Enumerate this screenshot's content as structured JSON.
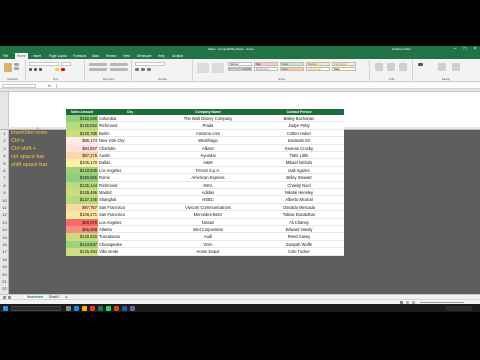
{
  "window": {
    "title": "Sales - Compatibility Mode - Excel",
    "user": "Charlie Kohler"
  },
  "ribbon_tabs": [
    "File",
    "Home",
    "Insert",
    "Page Layout",
    "Formulas",
    "Data",
    "Review",
    "View",
    "Developer",
    "Help",
    "Acrobat"
  ],
  "ribbon": {
    "groups": [
      "Clipboard",
      "Font",
      "Alignment",
      "Number",
      "Styles",
      "Cells",
      "Editing"
    ],
    "styles": [
      {
        "label": "Normal",
        "color": "#ffffff"
      },
      {
        "label": "Bad",
        "color": "#ffc7ce"
      },
      {
        "label": "Good",
        "color": "#c6efce"
      },
      {
        "label": "Neutral",
        "color": "#ffeb9c"
      },
      {
        "label": "Calculation",
        "color": "#f2f2f2"
      },
      {
        "label": "Check Cell",
        "color": "#a5a5a5"
      },
      {
        "label": "Explanatory",
        "color": "#ffffff"
      },
      {
        "label": "Input",
        "color": "#ffcc99"
      },
      {
        "label": "Linked Cell",
        "color": "#ffffff"
      },
      {
        "label": "Note",
        "color": "#ffffcc"
      }
    ]
  },
  "formula_bar": {
    "fx_label": "fx"
  },
  "notes": [
    "insert/del rows",
    "Ctrl s",
    "Ctrl shift +",
    "ctrl space bar",
    "shift space bar"
  ],
  "table": {
    "headers": [
      "Sales Amount",
      "City",
      "Company Name",
      "Contact Person"
    ],
    "rows": [
      {
        "amt": "$150,590",
        "city": "Columbia",
        "company": "The Walt Disney Company",
        "contact": "Bailey Buchanan",
        "color": "#8fcf7e"
      },
      {
        "amt": "$138,052",
        "city": "Richmond",
        "company": "Prada",
        "contact": "Jadyn Petty",
        "color": "#b6d97e"
      },
      {
        "amt": "$130,786",
        "city": "Berlin",
        "company": "Amazon.com",
        "contact": "Colten Huber",
        "color": "#c9dd7f"
      },
      {
        "amt": "$85,174",
        "city": "New York City",
        "company": "Westfriago",
        "contact": "Savanah Ori",
        "color": "#fde9e6"
      },
      {
        "amt": "$84,597",
        "city": "Charlotte",
        "company": "Allianz",
        "contact": "Keenan Crosby",
        "color": "#fbe1de"
      },
      {
        "amt": "$97,176",
        "city": "Austin",
        "company": "Hyundai",
        "contact": "Tahir Little",
        "color": "#fcd6a8"
      },
      {
        "amt": "$105,170",
        "city": "Dallas",
        "company": "H&M",
        "contact": "Mikael Nichols",
        "color": "#fbf0a8"
      },
      {
        "amt": "$143,536",
        "city": "Los Angeles",
        "company": "Ferrari S.p.A.",
        "contact": "Isak Aguirre",
        "color": "#9fd27e"
      },
      {
        "amt": "$150,966",
        "city": "Rome",
        "company": "American Express",
        "contact": "Briley Stewart",
        "color": "#8fcf7e"
      },
      {
        "amt": "$136,144",
        "city": "Richmond",
        "company": "IKEA",
        "contact": "Chasity Noel",
        "color": "#bdda7e"
      },
      {
        "amt": "$129,486",
        "city": "Madrid",
        "company": "Adidas",
        "contact": "Nikolai Hensley",
        "color": "#cbdd7f"
      },
      {
        "amt": "$137,165",
        "city": "Shanghai",
        "company": "HSBC",
        "contact": "Alberto Mconal",
        "color": "#b8d97e"
      },
      {
        "amt": "$97,757",
        "city": "San Francisco",
        "company": "Vivicom Communications",
        "contact": "Osvaldo Mercado",
        "color": "#fcd8a8"
      },
      {
        "amt": "$109,271",
        "city": "San Francisco",
        "company": "Mercedes-Benz",
        "contact": "Tobias Donaldson",
        "color": "#f8ea9e"
      },
      {
        "amt": "$60,076",
        "city": "Los Angeles",
        "company": "Nissan",
        "contact": "Ali Chaney",
        "color": "#f8696b"
      },
      {
        "amt": "$65,888",
        "city": "Atlanta",
        "company": "Intel Corporation",
        "contact": "Edward Handy",
        "color": "#f98d84"
      },
      {
        "amt": "$130,920",
        "city": "Tuscaloosa",
        "company": "Audi",
        "contact": "Reed Casey",
        "color": "#c9dd7f"
      },
      {
        "amt": "$144,847",
        "city": "Chesapeake",
        "company": "VISA",
        "contact": "Zaniyah Wolfe",
        "color": "#9fd27e"
      },
      {
        "amt": "$126,384",
        "city": "Villa Verde",
        "company": "Home Depot",
        "contact": "Cole Tucker",
        "color": "#d1de80"
      }
    ]
  },
  "sheet_tabs": [
    "Worksheet",
    "Sheet1"
  ]
}
